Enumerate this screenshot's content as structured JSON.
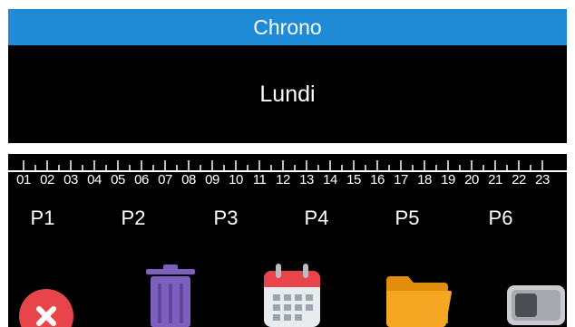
{
  "app": {
    "title": "Chrono"
  },
  "main": {
    "day": "Lundi"
  },
  "timeline": {
    "hours": [
      "01",
      "02",
      "03",
      "04",
      "05",
      "06",
      "07",
      "08",
      "09",
      "10",
      "11",
      "12",
      "13",
      "14",
      "15",
      "16",
      "17",
      "18",
      "19",
      "20",
      "21",
      "22",
      "23"
    ]
  },
  "periods": [
    "P1",
    "P2",
    "P3",
    "P4",
    "P5",
    "P6"
  ],
  "toolbar": {
    "buttons": [
      {
        "name": "close-button",
        "icon": "close-icon"
      },
      {
        "name": "delete-button",
        "icon": "trash-icon"
      },
      {
        "name": "calendar-button",
        "icon": "calendar-icon"
      },
      {
        "name": "folder-button",
        "icon": "folder-icon"
      },
      {
        "name": "toggle-button",
        "icon": "toggle-icon"
      }
    ]
  },
  "colors": {
    "titlebar": "#1f8ad6",
    "background": "#000000",
    "close": "#e8454a",
    "trash": "#7d5fbf",
    "calendar_accent": "#e8454a",
    "folder": "#f5a623"
  }
}
